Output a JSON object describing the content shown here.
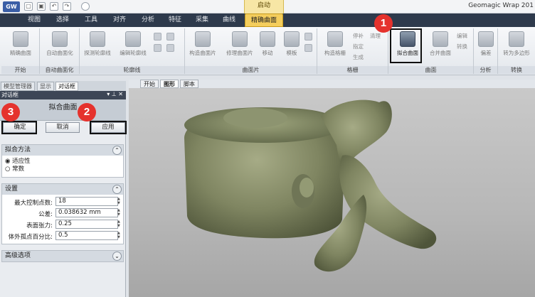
{
  "titlebar": {
    "logo": "GW",
    "context_tab": "启动",
    "window_title": "Geomagic Wrap 201"
  },
  "menu_tabs": [
    "视图",
    "选择",
    "工具",
    "对齐",
    "分析",
    "特征",
    "采集",
    "曲线",
    "精确曲面"
  ],
  "ribbon": {
    "groups": [
      "开始",
      "自动曲面化",
      "轮廓线",
      "曲面片",
      "格栅",
      "曲面",
      "分析",
      "转换"
    ],
    "buttons": {
      "fit_surface": "精确曲面",
      "auto_surface": "自动曲面化",
      "detect_contour": "探测轮廓线",
      "edit_contour": "编辑轮廓线",
      "construct_patches": "构造曲面片",
      "repair_patches": "修理曲面片",
      "move": "移动",
      "template": "模板",
      "construct_grid": "构造格栅",
      "stop": "停补",
      "specify": "指定",
      "generate": "生成",
      "fit": "清理",
      "fit_surfaces": "拟合曲面",
      "merge_surfaces": "合并曲面",
      "edit": "编辑",
      "convert": "转换",
      "deviation": "偏差",
      "to_polygon": "转为多边形"
    }
  },
  "left_panel": {
    "tabs": [
      "模型管理器",
      "显示",
      "对话框"
    ],
    "panel_title": "对话框",
    "dialog_title": "拟合曲面",
    "ok_label": "确定",
    "cancel_label": "取消",
    "apply_label": "应用",
    "fit_method": {
      "title": "拟合方法",
      "options": [
        "适应性",
        "常数"
      ],
      "selected": "适应性"
    },
    "settings": {
      "title": "设置",
      "fields": [
        {
          "label": "最大控制点数:",
          "value": "18"
        },
        {
          "label": "公差:",
          "value": "0.038632 mm"
        },
        {
          "label": "表面张力:",
          "value": "0.25"
        },
        {
          "label": "体外孤点百分比:",
          "value": "0.5"
        }
      ]
    },
    "advanced": {
      "title": "高级选项"
    }
  },
  "viewport_tabs": [
    "开始",
    "图形",
    "脚本"
  ],
  "badges": [
    "1",
    "2",
    "3"
  ]
}
